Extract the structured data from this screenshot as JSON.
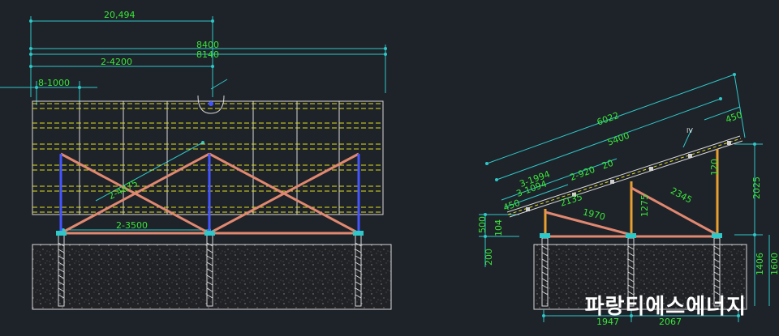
{
  "front_view": {
    "dims": {
      "overall_top": "20,494",
      "total_a": "8400",
      "total_b": "8140",
      "half_span": "2-4200",
      "bay": "8-1000",
      "brace_diag": "2-4875",
      "post_spacing": "2-3500"
    }
  },
  "side_view": {
    "dims": {
      "rail_length": "6022",
      "inner_length": "5400",
      "purlin_a": "3-1994",
      "purlin_b": "3-1094",
      "purlin_c": "2-920",
      "purlin_d": "20",
      "end_left": "450",
      "end_right": "450",
      "brace_a": "2135",
      "brace_b": "1970",
      "brace_c": "2345",
      "post_mid": "1275",
      "post_right": "120",
      "height_right": "2025",
      "height_left": "500",
      "height_left_b": "200",
      "small_left": "104",
      "found_a": "1406",
      "found_b": "1600",
      "bottom_a": "1947",
      "bottom_b": "2067",
      "label_iv": "IV"
    }
  },
  "brand": {
    "text": "파랑티에스에너지"
  },
  "colors": {
    "background": "#1e2229",
    "dimension": "#39e639",
    "dimension_line": "#2ec8c8",
    "rail": "#e0e01a",
    "brace": "#e08870",
    "post": "#4455ff",
    "frame": "#d8d8d8",
    "ground": "#5a5a5a"
  }
}
